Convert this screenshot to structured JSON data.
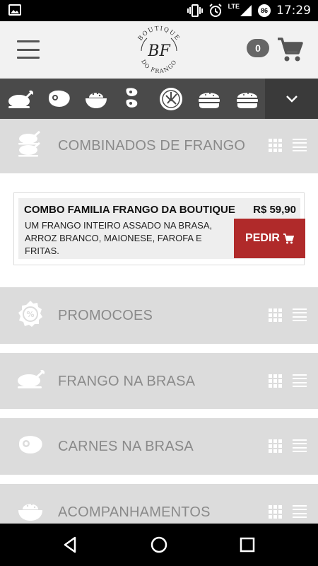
{
  "status_bar": {
    "time": "17:29",
    "network": "LTE",
    "battery": "86"
  },
  "header": {
    "logo_text_top": "BOUTIQUE",
    "logo_monogram": "BF",
    "logo_text_bottom": "DO FRANGO",
    "cart_count": "0"
  },
  "category_icons": [
    "chicken-icon",
    "steak-icon",
    "rice-bowl-icon",
    "meat-skewer-icon",
    "salad-icon",
    "burger-icon",
    "burger-icon"
  ],
  "sections": [
    {
      "title": "COMBINADOS DE FRANGO",
      "icon": "stacked-chicken-icon"
    },
    {
      "title": "PROMOCOES",
      "icon": "discount-badge-icon"
    },
    {
      "title": "FRANGO NA BRASA",
      "icon": "chicken-icon"
    },
    {
      "title": "CARNES NA BRASA",
      "icon": "steak-icon"
    },
    {
      "title": "ACOMPANHAMENTOS",
      "icon": "rice-bowl-icon"
    }
  ],
  "product": {
    "name": "COMBO FAMILIA FRANGO DA BOUTIQUE",
    "price": "R$ 59,90",
    "description": "UM FRANGO INTEIRO ASSADO NA BRASA, ARROZ BRANCO, MAIONESE, FAROFA E FRITAS.",
    "order_label": "PEDIR"
  },
  "colors": {
    "accent": "#b02a2a",
    "strip": "#4a4a4a",
    "section_bg": "#dcdcdc",
    "header_bg": "#f2f2f2"
  }
}
